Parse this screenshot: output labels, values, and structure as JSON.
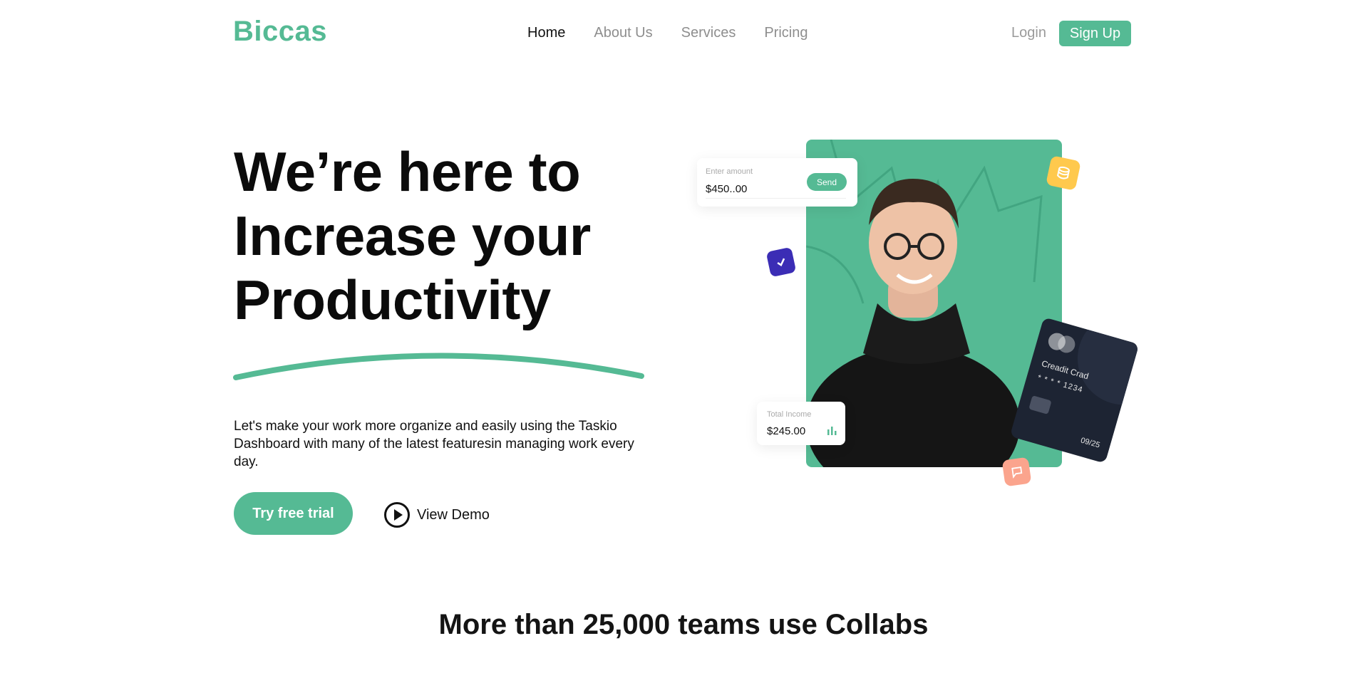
{
  "brand": {
    "name": "Biccas",
    "accent": "#55ba94"
  },
  "nav": {
    "items": [
      "Home",
      "About Us",
      "Services",
      "Pricing"
    ],
    "active": "Home",
    "login": "Login",
    "signup": "Sign Up"
  },
  "hero": {
    "title_lines": [
      "We’re here to",
      "Increase your",
      "Productivity"
    ],
    "description": "Let's make your work more organize and easily using the Taskio Dashboard with many of the latest featuresin managing work every day.",
    "primary_cta": "Try free trial",
    "secondary_cta": "View Demo"
  },
  "illustration": {
    "amount_card": {
      "label": "Enter amount",
      "value": "$450..00",
      "button": "Send"
    },
    "income_card": {
      "label": "Total Income",
      "value": "$245.00"
    },
    "credit_card": {
      "name": "Creadit Crad",
      "number": "* * * *  1234",
      "expiry": "09/25"
    },
    "icons": [
      "check-icon",
      "coins-icon",
      "chat-icon",
      "bar-chart-icon"
    ],
    "colors": {
      "check": "#3b2db5",
      "coin": "#ffc94d",
      "chat": "#fba48d",
      "card": "#1d2433"
    }
  },
  "social_proof": {
    "heading": "More than 25,000 teams use Collabs"
  }
}
